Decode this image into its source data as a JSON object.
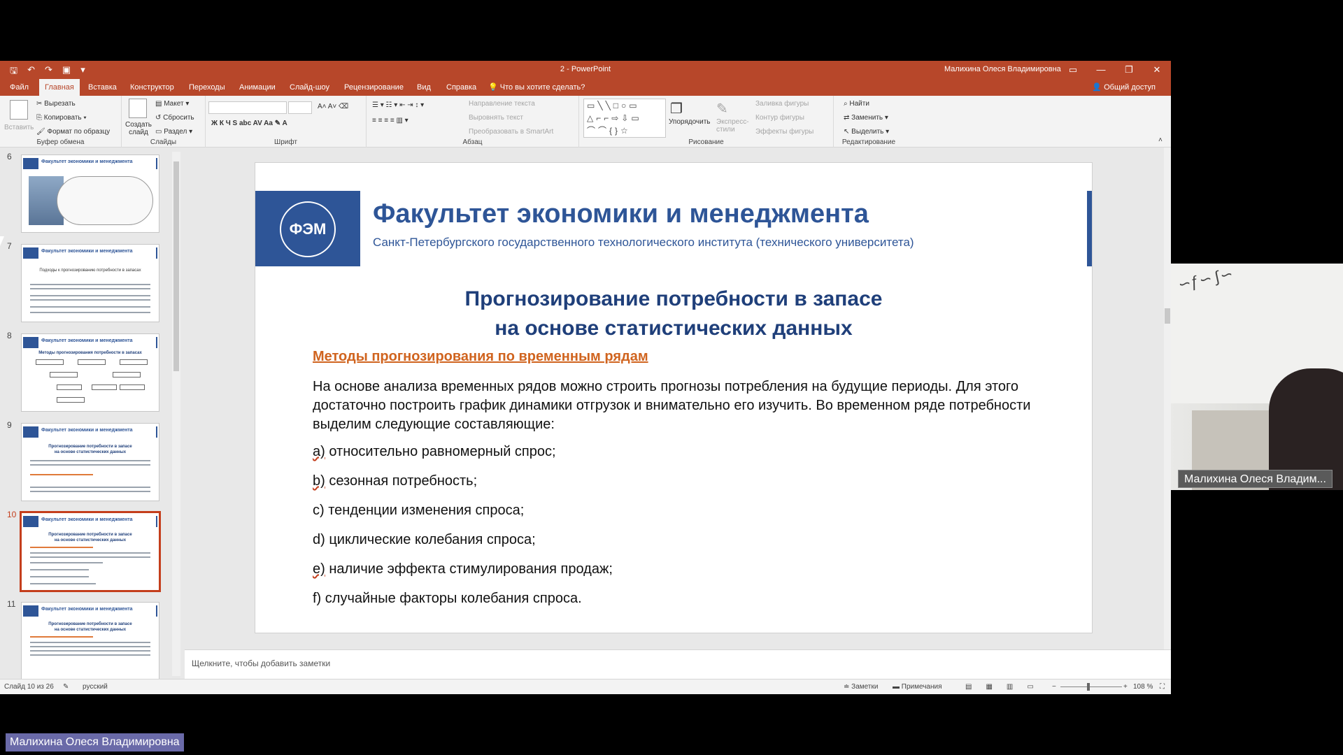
{
  "window": {
    "title": "2  -  PowerPoint",
    "user": "Малихина Олеся Владимировна",
    "share": "Общий доступ"
  },
  "tabs": [
    "Файл",
    "Главная",
    "Вставка",
    "Конструктор",
    "Переходы",
    "Анимации",
    "Слайд-шоу",
    "Рецензирование",
    "Вид",
    "Справка",
    "Что вы хотите сделать?"
  ],
  "ribbon": {
    "clipboard": {
      "paste": "Вставить",
      "cut": "Вырезать",
      "copy": "Копировать",
      "format": "Формат по образцу",
      "label": "Буфер обмена"
    },
    "slides": {
      "new": "Создать слайд",
      "layout": "Макет",
      "reset": "Сбросить",
      "section": "Раздел",
      "label": "Слайды"
    },
    "font": {
      "label": "Шрифт"
    },
    "paragraph": {
      "direction": "Направление текста",
      "align": "Выровнять текст",
      "smartart": "Преобразовать в SmartArt",
      "label": "Абзац"
    },
    "drawing": {
      "arrange": "Упорядочить",
      "styles": "Экспресс-стили",
      "fill": "Заливка фигуры",
      "outline": "Контур фигуры",
      "effects": "Эффекты фигуры",
      "label": "Рисование"
    },
    "editing": {
      "find": "Найти",
      "replace": "Заменить",
      "select": "Выделить",
      "label": "Редактирование"
    }
  },
  "thumbs": {
    "numbers": [
      "6",
      "7",
      "8",
      "9",
      "10",
      "11"
    ],
    "header": "Факультет экономики и менеджмента",
    "t7": "Подходы к прогнозированию потребности в запасах",
    "t8": "Методы прогнозирования потребности в запасах",
    "t9a": "Прогнозирование потребности в запасе",
    "t9b": "на основе статистических данных"
  },
  "slide": {
    "logo": "ФЭМ",
    "faculty": "Факультет экономики и менеджмента",
    "institute": "Санкт-Петербургского государственного технологического института (технического университета)",
    "title1": "Прогнозирование потребности в запасе",
    "title2": "на основе статистических данных",
    "subtitle": "Методы прогнозирования по временным рядам",
    "paragraph": "На основе анализа временных рядов можно строить прогнозы потребления на будущие периоды. Для этого достаточно построить график динамики отгрузок и внимательно его изучить. Во временном ряде потребности выделим следующие составляющие:",
    "items": [
      {
        "m": "а)",
        "t": " относительно равномерный спрос;"
      },
      {
        "m": "b)",
        "t": " сезонная потребность;"
      },
      {
        "m": "c)",
        "t": " тенденции изменения спроса;"
      },
      {
        "m": "d)",
        "t": " циклические колебания спроса;"
      },
      {
        "m": "e)",
        "t": " наличие эффекта стимулирования продаж;"
      },
      {
        "m": "f)",
        "t": " случайные факторы колебания спроса."
      }
    ]
  },
  "notes": "Щелкните, чтобы добавить заметки",
  "status": {
    "slide": "Слайд 10 из 26",
    "lang": "русский",
    "notes": "Заметки",
    "comments": "Примечания",
    "zoom": "108 %"
  },
  "video": {
    "name": "Малихина Олеся Владим..."
  },
  "bottom_name": "Малихина Олеся Владимировна",
  "colors": {
    "accent": "#b7472a",
    "brand_blue": "#2e5597",
    "subtitle_orange": "#d0641f"
  }
}
